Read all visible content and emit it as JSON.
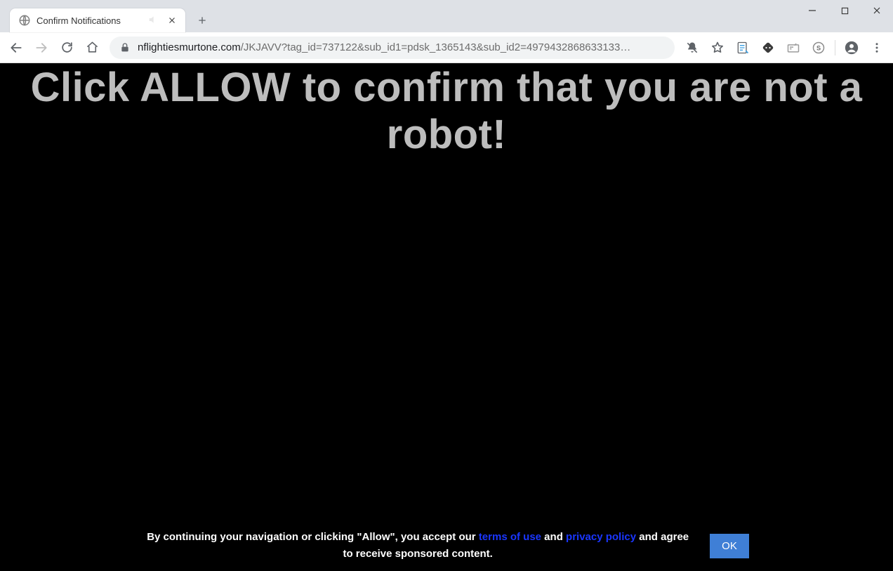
{
  "window": {
    "tab_title": "Confirm Notifications"
  },
  "toolbar": {
    "url_host": "nflightiesmurtone.com",
    "url_path": "/JKJAVV?tag_id=737122&sub_id1=pdsk_1365143&sub_id2=4979432868633133…"
  },
  "page": {
    "hero": "Click ALLOW to confirm that you are not a robot!",
    "consent_before": "By continuing your navigation or clicking \"Allow\", you accept our ",
    "terms_link": "terms of use",
    "consent_and": " and ",
    "privacy_link": "privacy policy",
    "consent_after": " and agree to receive sponsored content.",
    "ok_label": "OK"
  }
}
